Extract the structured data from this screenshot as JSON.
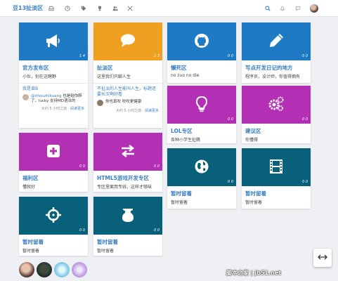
{
  "header": {
    "brand": "豆13扯淡区",
    "nav_icons": [
      "inbox-icon",
      "clock-icon",
      "tags-icon",
      "trophy-icon",
      "users-icon",
      "network-icon"
    ],
    "right_icons": [
      "search-icon",
      "bell-icon",
      "chat-icon"
    ]
  },
  "categories": [
    {
      "title": "官方发布区",
      "desc": "小伙，别在这瞎野",
      "stats": "1  4",
      "icon": "megaphone-icon",
      "color": "#1f7ac5",
      "post": {
        "title": "我是谁B",
        "reply_user": "@zhouzhikuang",
        "reply_text": "也是给你醉了，lucky 支持MD语法的",
        "meta": "大约 5 小时之前",
        "more": "阅读更多"
      }
    },
    {
      "title": "扯淡区",
      "desc": "这里我们只聊人生",
      "stats": "1  3",
      "icon": "speech-bubble-icon",
      "color": "#f0a020",
      "post": {
        "title": "不扯淡的人生能叫人生，标题还要长次啊好看",
        "reply_user": "",
        "reply_text": "你也真吹 吹吹更健康",
        "meta": "大约 5 小时之前",
        "more": "阅读更多"
      }
    },
    {
      "title": "懒死区",
      "desc": "no zuo no die",
      "stats": "0  0",
      "icon": "github-icon",
      "color": "#1f7ac5"
    },
    {
      "title": "写点开发日记的地方",
      "desc": "程序员，设计师，你值得拥有",
      "stats": "0  0",
      "icon": "pencil-icon",
      "color": "#1f7ac5"
    },
    {
      "title": "LOL专区",
      "desc": "各种小学生扯腾",
      "stats": "0  0",
      "icon": "lightbulb-icon",
      "color": "#b32fb3"
    },
    {
      "title": "建议区",
      "desc": "你懂得",
      "stats": "0  0",
      "icon": "gears-icon",
      "color": "#b32fb3"
    },
    {
      "title": "福利区",
      "desc": "懂就好",
      "stats": "0  0",
      "icon": "plus-square-icon",
      "color": "#b32fb3"
    },
    {
      "title": "HTML5游戏开发专区",
      "desc": "专区里面用专线，这样才够味",
      "stats": "0  0",
      "icon": "exchange-icon",
      "color": "#b32fb3"
    },
    {
      "title": "暂时留着",
      "desc": "暂时留着",
      "stats": "0  0",
      "icon": "globe-icon",
      "color": "#09607a"
    },
    {
      "title": "暂时留着",
      "desc": "暂时留着",
      "stats": "0  0",
      "icon": "film-icon",
      "color": "#09607a"
    },
    {
      "title": "暂时留着",
      "desc": "暂时留着",
      "stats": "0  0",
      "icon": "crosshairs-icon",
      "color": "#09607a"
    },
    {
      "title": "暂时留着",
      "desc": "暂时留着",
      "stats": "0  0",
      "icon": "flask-icon",
      "color": "#09607a"
    }
  ],
  "footer": {
    "avatars": [
      "avatar-1",
      "avatar-2",
      "avatar-3",
      "avatar-4"
    ],
    "watermark": "脚本之家 | jb51.net"
  }
}
